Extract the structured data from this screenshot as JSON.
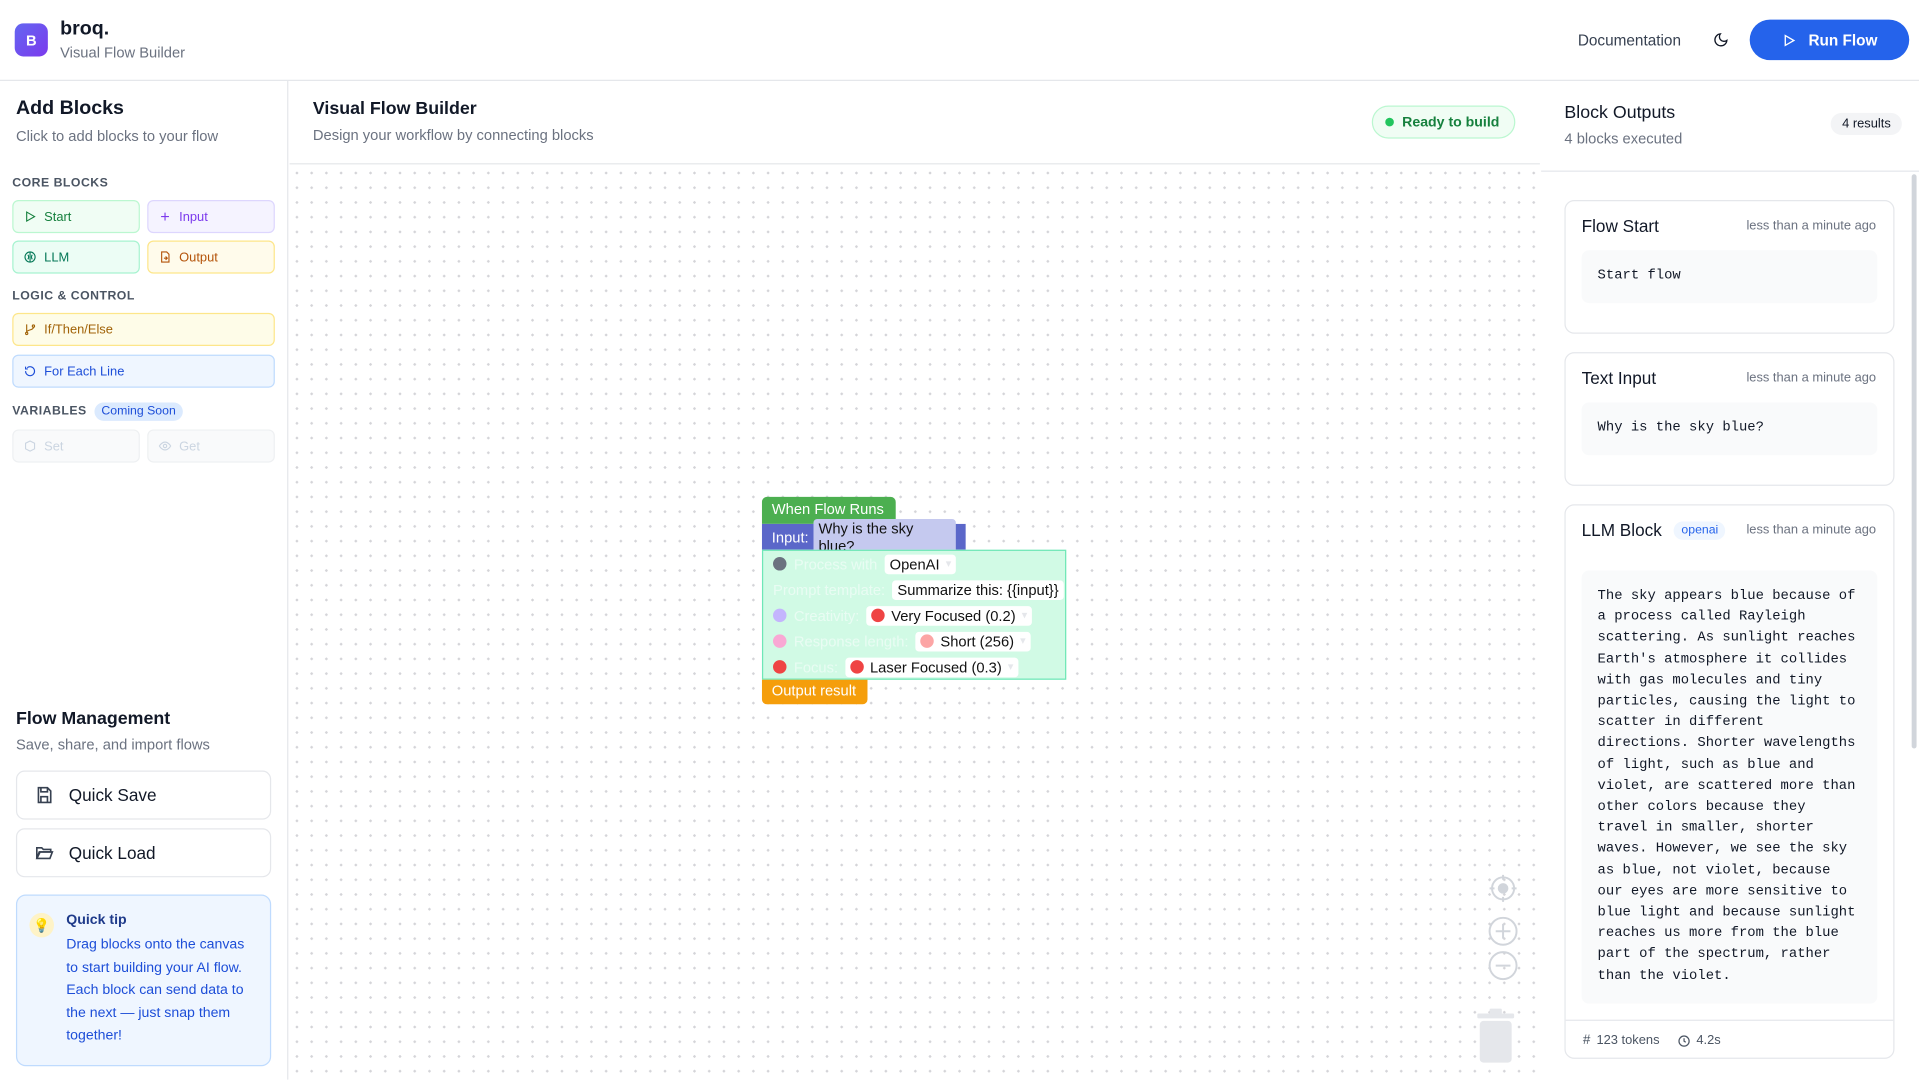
{
  "header": {
    "logo_letter": "B",
    "app_name": "broq.",
    "app_subtitle": "Visual Flow Builder",
    "doc_link": "Documentation",
    "run_label": "Run Flow"
  },
  "sidebar": {
    "title": "Add Blocks",
    "subtitle": "Click to add blocks to your flow",
    "core_title": "CORE BLOCKS",
    "core": [
      "Start",
      "Input",
      "LLM",
      "Output"
    ],
    "logic_title": "LOGIC & CONTROL",
    "logic": [
      "If/Then/Else",
      "For Each Line"
    ],
    "variables_title": "VARIABLES",
    "variables_badge": "Coming Soon",
    "variables": [
      "Set",
      "Get"
    ],
    "fm_title": "Flow Management",
    "fm_subtitle": "Save, share, and import flows",
    "quick_save": "Quick Save",
    "quick_load": "Quick Load",
    "tip_title": "Quick tip",
    "tip_text": "Drag blocks onto the canvas to start building your AI flow. Each block can send data to the next — just snap them together!"
  },
  "canvas": {
    "title": "Visual Flow Builder",
    "subtitle": "Design your workflow by connecting blocks",
    "status": "Ready to build",
    "blocks": {
      "hat": "When Flow Runs",
      "input_label": "Input:",
      "input_value": "Why is the sky blue?",
      "process_label": "Process with",
      "process_value": "OpenAI",
      "prompt_label": "Prompt template:",
      "prompt_value": "Summarize this: {{input}}",
      "creativity_label": "Creativity:",
      "creativity_value": "Very Focused (0.2)",
      "length_label": "Response length:",
      "length_value": "Short (256)",
      "focus_label": "Focus:",
      "focus_value": "Laser Focused (0.3)",
      "output": "Output result"
    }
  },
  "outputs": {
    "title": "Block Outputs",
    "subtitle": "4 blocks executed",
    "count_badge": "4 results",
    "cards": [
      {
        "name": "Flow Start",
        "time": "less than a minute ago",
        "body": "Start flow"
      },
      {
        "name": "Text Input",
        "time": "less than a minute ago",
        "body": "Why is the sky blue?"
      },
      {
        "name": "LLM Block",
        "tag": "openai",
        "time": "less than a minute ago",
        "body": "The sky appears blue because of a process called Rayleigh scattering. As sunlight reaches Earth's atmosphere it collides with gas molecules and tiny particles, causing the light to scatter in different directions. Shorter wavelengths of light, such as blue and violet, are scattered more than other colors because they travel in smaller, shorter waves. However, we see the sky as blue, not violet, because our eyes are more sensitive to blue light and because sunlight reaches us more from the blue part of the spectrum, rather than the violet.",
        "tokens": "123 tokens",
        "duration": "4.2s"
      }
    ]
  }
}
